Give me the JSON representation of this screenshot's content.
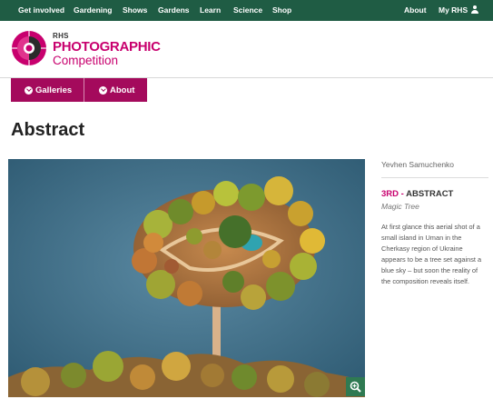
{
  "topnav": {
    "items": [
      "Get involved",
      "Gardening",
      "Shows",
      "Gardens",
      "Learn",
      "Science",
      "Shop"
    ],
    "about": "About",
    "my_rhs": "My RHS"
  },
  "brand": {
    "org": "RHS",
    "line1": "PHOTOGRAPHIC",
    "line2": "Competition"
  },
  "subnav": {
    "galleries": "Galleries",
    "about": "About"
  },
  "page": {
    "title": "Abstract"
  },
  "entry": {
    "photographer": "Yevhen Samuchenko",
    "rank": "3RD",
    "separator": " - ",
    "category": "ABSTRACT",
    "photo_title": "Magic Tree",
    "description": "At first glance this aerial shot of a small island in Uman in the Cherkasy region of Ukraine appears to be a tree set against a blue sky – but soon the reality of the composition reveals itself."
  },
  "colors": {
    "topnav_bg": "#1f5c44",
    "brand_pink": "#c8006e",
    "subnav_bg": "#a40a5c",
    "zoom_bg": "#2f7a52"
  },
  "icons": {
    "user": "user-icon",
    "chevron": "chevron-down-circle-icon",
    "zoom": "zoom-in-icon"
  }
}
